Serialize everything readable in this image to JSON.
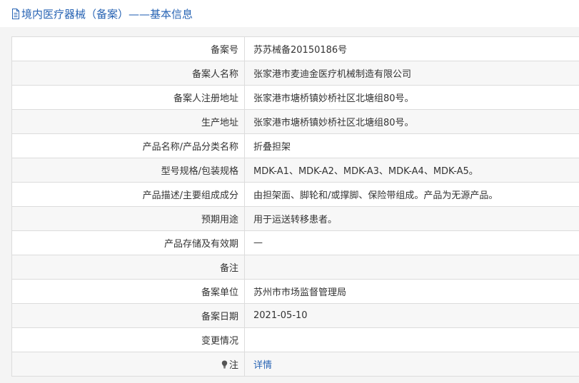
{
  "header": {
    "icon": "document-icon",
    "title": "境内医疗器械（备案）——基本信息"
  },
  "rows": [
    {
      "label": "备案号",
      "value": "苏苏械备20150186号"
    },
    {
      "label": "备案人名称",
      "value": "张家港市麦迪金医疗机械制造有限公司"
    },
    {
      "label": "备案人注册地址",
      "value": "张家港市塘桥镇妙桥社区北塘组80号。"
    },
    {
      "label": "生产地址",
      "value": "张家港市塘桥镇妙桥社区北塘组80号。"
    },
    {
      "label": "产品名称/产品分类名称",
      "value": "折叠担架"
    },
    {
      "label": "型号规格/包装规格",
      "value": "MDK-A1、MDK-A2、MDK-A3、MDK-A4、MDK-A5。"
    },
    {
      "label": "产品描述/主要组成成分",
      "value": "由担架面、脚轮和/或撑脚、保险带组成。产品为无源产品。"
    },
    {
      "label": "预期用途",
      "value": "用于运送转移患者。"
    },
    {
      "label": "产品存储及有效期",
      "value": "—"
    },
    {
      "label": "备注",
      "value": ""
    },
    {
      "label": "备案单位",
      "value": "苏州市市场监督管理局"
    },
    {
      "label": "备案日期",
      "value": "2021-05-10"
    },
    {
      "label": "变更情况",
      "value": ""
    }
  ],
  "note_row": {
    "icon": "lightbulb-icon",
    "label": "注",
    "link_text": "详情"
  },
  "colors": {
    "accent": "#2864b4",
    "border": "#dcdcdc",
    "row_alt": "#f7f7f7"
  }
}
